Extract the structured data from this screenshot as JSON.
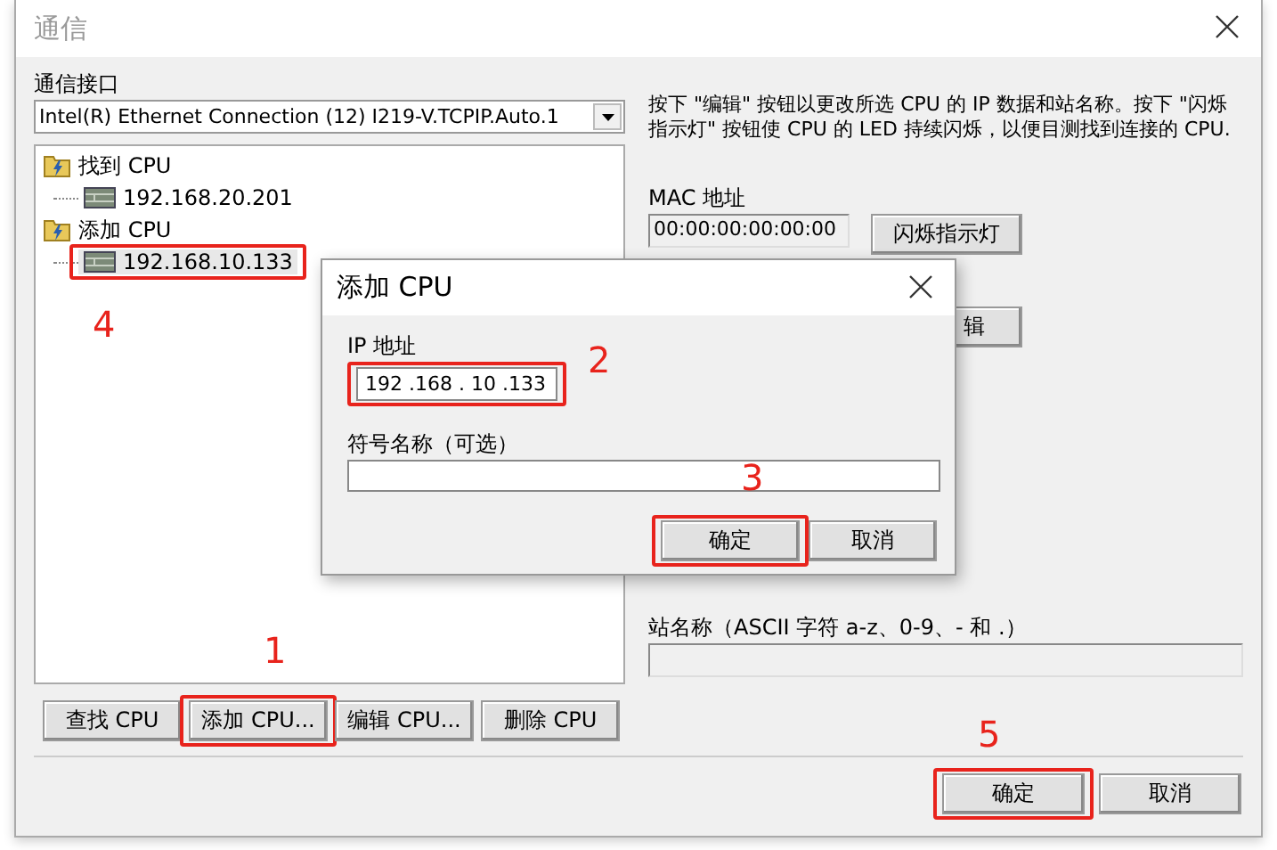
{
  "window": {
    "title": "通信"
  },
  "interface": {
    "label": "通信接口",
    "value": "Intel(R) Ethernet Connection (12) I219-V.TCPIP.Auto.1"
  },
  "tree": [
    {
      "label": "找到 CPU",
      "children": [
        {
          "label": "192.168.20.201",
          "selected": false,
          "highlighted": false
        }
      ]
    },
    {
      "label": "添加 CPU",
      "children": [
        {
          "label": "192.168.10.133",
          "selected": true,
          "highlighted": true
        }
      ]
    }
  ],
  "info_text": "按下 \"编辑\" 按钮以更改所选 CPU 的 IP 数据和站名称。按下 \"闪烁指示灯\" 按钮使 CPU 的 LED 持续闪烁，以便目测找到连接的 CPU.",
  "mac": {
    "label": "MAC 地址",
    "value": "00:00:00:00:00:00"
  },
  "blink_button": "闪烁指示灯",
  "edit_button": "辑",
  "station": {
    "label": "站名称（ASCII 字符 a-z、0-9、- 和 .）"
  },
  "cpu_buttons": [
    {
      "label": "查找 CPU",
      "highlighted": false
    },
    {
      "label": "添加 CPU...",
      "highlighted": true
    },
    {
      "label": "编辑 CPU...",
      "highlighted": false
    },
    {
      "label": "删除 CPU",
      "highlighted": false
    }
  ],
  "footer_buttons": [
    {
      "label": "确定",
      "highlighted": true
    },
    {
      "label": "取消",
      "highlighted": false
    }
  ],
  "add_dialog": {
    "title": "添加 CPU",
    "ip_label": "IP 地址",
    "ip_value": "192 .168 . 10 .133",
    "ip_highlighted": true,
    "name_label": "符号名称（可选）",
    "buttons": [
      {
        "label": "确定",
        "highlighted": true
      },
      {
        "label": "取消",
        "highlighted": false
      }
    ]
  },
  "annotations": [
    "1",
    "2",
    "3",
    "4",
    "5"
  ]
}
